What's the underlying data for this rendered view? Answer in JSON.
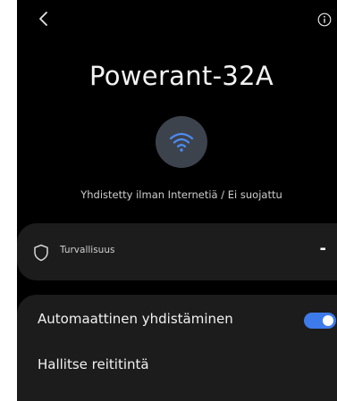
{
  "network": {
    "name": "Powerant-32A",
    "status": "Yhdistetty ilman Internetiä / Ei suojattu"
  },
  "security": {
    "label": "Turvallisuus",
    "value": "-"
  },
  "settings": {
    "auto_connect_label": "Automaattinen yhdistäminen",
    "auto_connect_on": true,
    "manage_router_label": "Hallitse reititintä"
  },
  "colors": {
    "accent": "#3e7bea",
    "background": "#000000",
    "card": "#1c1c1c"
  },
  "icons": {
    "back": "back-arrow-icon",
    "info": "info-icon",
    "wifi": "wifi-icon",
    "shield": "shield-icon"
  }
}
